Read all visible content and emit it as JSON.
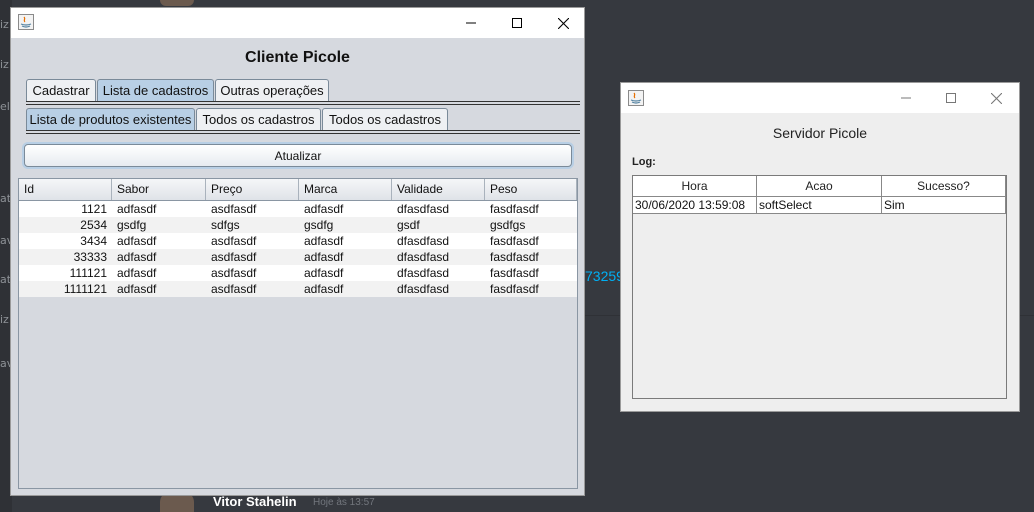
{
  "background": {
    "sidebar_fragments": [
      "iz",
      "els",
      "at",
      "av",
      "at",
      "iz",
      "av"
    ],
    "link_fragment": "73259",
    "username": "Vitor Stahelin",
    "timestamp": "Hoje às 13:57"
  },
  "client_window": {
    "heading": "Cliente Picole",
    "tabs": [
      "Cadastrar",
      "Lista de cadastros",
      "Outras operações"
    ],
    "selected_tab": "Lista de cadastros",
    "subtabs": [
      "Lista de produtos existentes",
      "Todos os cadastros",
      "Todos os cadastros"
    ],
    "selected_subtab": "Lista de produtos existentes",
    "refresh_button": "Atualizar",
    "table": {
      "columns": [
        "Id",
        "Sabor",
        "Preço",
        "Marca",
        "Validade",
        "Peso"
      ],
      "rows": [
        [
          "1121",
          "adfasdf",
          "asdfasdf",
          "adfasdf",
          "dfasdfasd",
          "fasdfasdf"
        ],
        [
          "2534",
          "gsdfg",
          "sdfgs",
          "gsdfg",
          "gsdf",
          "gsdfgs"
        ],
        [
          "3434",
          "adfasdf",
          "asdfasdf",
          "adfasdf",
          "dfasdfasd",
          "fasdfasdf"
        ],
        [
          "33333",
          "adfasdf",
          "asdfasdf",
          "adfasdf",
          "dfasdfasd",
          "fasdfasdf"
        ],
        [
          "111121",
          "adfasdf",
          "asdfasdf",
          "adfasdf",
          "dfasdfasd",
          "fasdfasdf"
        ],
        [
          "1111121",
          "adfasdf",
          "asdfasdf",
          "adfasdf",
          "dfasdfasd",
          "fasdfasdf"
        ]
      ]
    }
  },
  "server_window": {
    "heading": "Servidor Picole",
    "log_label": "Log:",
    "log_table": {
      "columns": [
        "Hora",
        "Acao",
        "Sucesso?"
      ],
      "rows": [
        [
          "30/06/2020 13:59:08",
          "softSelect",
          "Sim"
        ]
      ]
    }
  },
  "titlebar_glyphs": {
    "minimize": "—",
    "maximize": "☐",
    "close": "✕"
  },
  "colors": {
    "selected_tab": "#b8cfe5",
    "link": "#00b0f4",
    "desktop": "#36393f"
  }
}
